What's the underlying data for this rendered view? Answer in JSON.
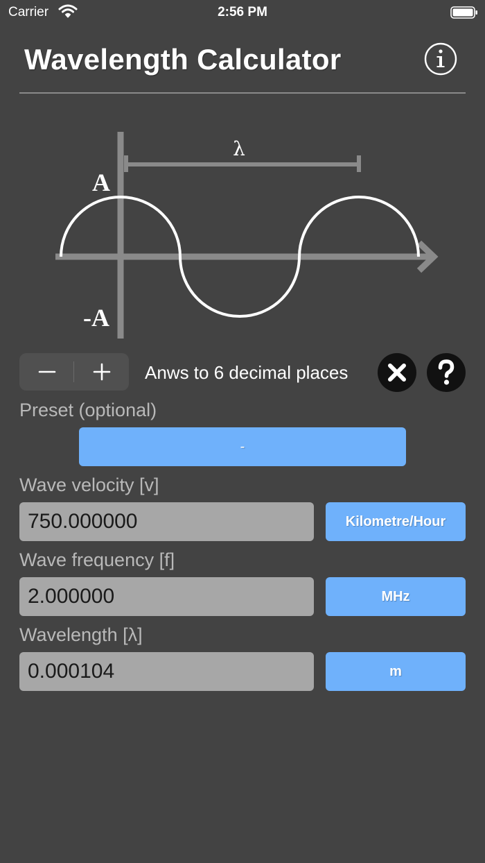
{
  "status_bar": {
    "carrier": "Carrier",
    "time": "2:56 PM"
  },
  "header": {
    "title": "Wavelength Calculator",
    "info_icon": "info-circle-icon"
  },
  "diagram": {
    "lambda_label": "λ",
    "amplitude_label": "A",
    "neg_amplitude_label": "-A"
  },
  "decimals": {
    "minus_label": "−",
    "plus_label": "+",
    "text": "Anws to 6 decimal places",
    "clear_icon": "close-circle-icon",
    "help_icon": "help-circle-icon"
  },
  "form": {
    "preset": {
      "label": "Preset (optional)",
      "value": "-"
    },
    "velocity": {
      "label": "Wave velocity [v]",
      "value": "750.000000",
      "unit": "Kilometre/Hour"
    },
    "frequency": {
      "label": "Wave frequency [f]",
      "value": "2.000000",
      "unit": "MHz"
    },
    "wavelength": {
      "label": "Wavelength [λ]",
      "value": "0.000104",
      "unit": "m"
    }
  },
  "colors": {
    "background": "#434343",
    "accent_button": "#6fb1fb",
    "input_field": "#a7a7a7",
    "label_text": "#b9b9b9"
  }
}
